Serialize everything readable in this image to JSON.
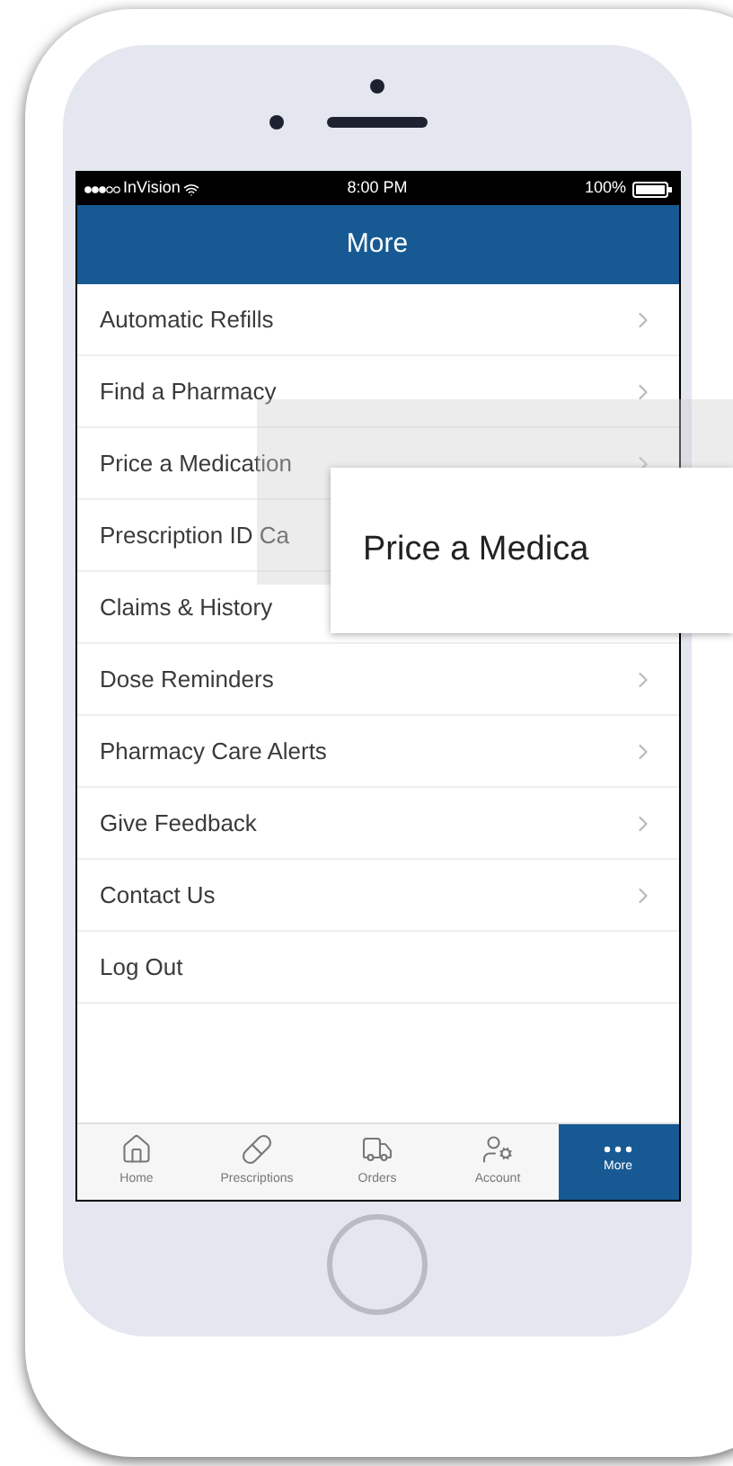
{
  "status_bar": {
    "carrier": "InVision",
    "time": "8:00 PM",
    "battery": "100%"
  },
  "header": {
    "title": "More"
  },
  "menu": [
    {
      "label": "Automatic Refills",
      "chevron": true
    },
    {
      "label": "Find a Pharmacy",
      "chevron": true
    },
    {
      "label": "Price a Medication",
      "chevron": true
    },
    {
      "label": "Prescription ID Ca"
    },
    {
      "label": "Claims & History"
    },
    {
      "label": "Dose Reminders",
      "chevron": true
    },
    {
      "label": "Pharmacy Care Alerts",
      "chevron": true
    },
    {
      "label": "Give Feedback",
      "chevron": true
    },
    {
      "label": "Contact Us",
      "chevron": true
    },
    {
      "label": "Log Out",
      "chevron": false
    }
  ],
  "tab_bar": [
    {
      "label": "Home",
      "selected": false
    },
    {
      "label": "Prescriptions",
      "selected": false
    },
    {
      "label": "Orders",
      "selected": false
    },
    {
      "label": "Account",
      "selected": false
    },
    {
      "label": "More",
      "selected": true
    }
  ],
  "tooltip": {
    "text": "Price a Medica"
  }
}
